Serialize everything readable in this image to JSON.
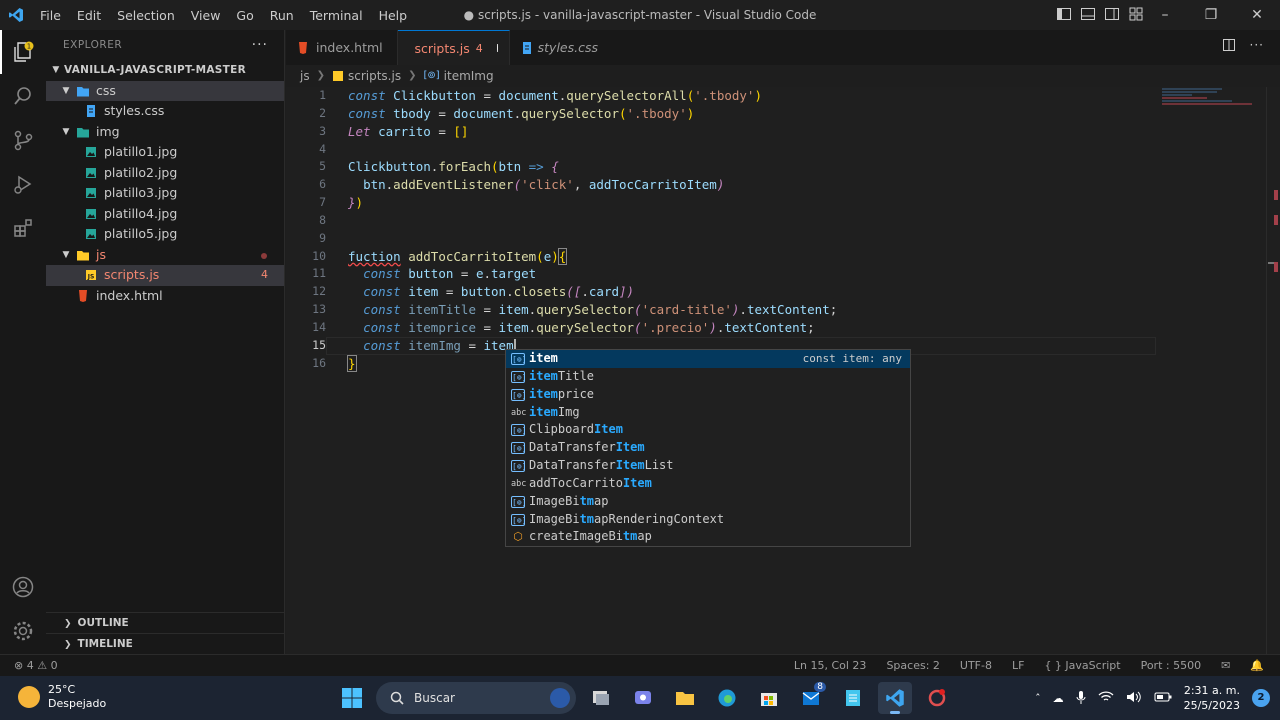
{
  "window": {
    "title": "● scripts.js - vanilla-javascript-master - Visual Studio Code",
    "menu": [
      "File",
      "Edit",
      "Selection",
      "View",
      "Go",
      "Run",
      "Terminal",
      "Help"
    ]
  },
  "sidebar": {
    "title": "EXPLORER",
    "root": "VANILLA-JAVASCRIPT-MASTER",
    "tree": [
      {
        "label": "css",
        "type": "folder"
      },
      {
        "label": "styles.css",
        "type": "css"
      },
      {
        "label": "img",
        "type": "folder"
      },
      {
        "label": "platillo1.jpg",
        "type": "image"
      },
      {
        "label": "platillo2.jpg",
        "type": "image"
      },
      {
        "label": "platillo3.jpg",
        "type": "image"
      },
      {
        "label": "platillo4.jpg",
        "type": "image"
      },
      {
        "label": "platillo5.jpg",
        "type": "image"
      },
      {
        "label": "js",
        "type": "folder"
      },
      {
        "label": "scripts.js",
        "type": "js",
        "problems": "4"
      },
      {
        "label": "index.html",
        "type": "html"
      }
    ],
    "outline": "OUTLINE",
    "timeline": "TIMELINE"
  },
  "tabs": [
    {
      "label": "index.html"
    },
    {
      "label": "scripts.js",
      "problems": "4"
    },
    {
      "label": "styles.css"
    }
  ],
  "breadcrumb": {
    "folder": "js",
    "file": "scripts.js",
    "symbol": "itemImg"
  },
  "editor": {
    "line_numbers": [
      "1",
      "2",
      "3",
      "4",
      "5",
      "6",
      "7",
      "8",
      "9",
      "10",
      "11",
      "12",
      "13",
      "14",
      "15",
      "16"
    ],
    "current_line": "15"
  },
  "suggest": {
    "items": [
      {
        "pre": "",
        "hl": "item",
        "post": "",
        "kind": "var"
      },
      {
        "pre": "",
        "hl": "item",
        "post": "Title",
        "kind": "var"
      },
      {
        "pre": "",
        "hl": "item",
        "post": "price",
        "kind": "var"
      },
      {
        "pre": "",
        "hl": "item",
        "post": "Img",
        "kind": "abc"
      },
      {
        "pre": "Clipboard",
        "hl": "Item",
        "post": "",
        "kind": "var"
      },
      {
        "pre": "DataTransfer",
        "hl": "Item",
        "post": "",
        "kind": "var"
      },
      {
        "pre": "DataTransfer",
        "hl": "Item",
        "post": "List",
        "kind": "var"
      },
      {
        "pre": "addTocCarrito",
        "hl": "Item",
        "post": "",
        "kind": "abc"
      },
      {
        "pre": "ImageBi",
        "hl": "tm",
        "post": "ap",
        "kind": "var"
      },
      {
        "pre": "ImageBi",
        "hl": "tm",
        "post": "apRenderingContext",
        "kind": "var"
      },
      {
        "pre": "createImageBi",
        "hl": "tm",
        "post": "ap",
        "kind": "cls"
      }
    ],
    "detail": "const item: any"
  },
  "statusbar": {
    "problems": "⊗ 4 ⚠ 0",
    "position": "Ln 15, Col 23",
    "spaces": "Spaces: 2",
    "encoding": "UTF-8",
    "eol": "LF",
    "language": "{ } JavaScript",
    "port": "Port : 5500"
  },
  "taskbar": {
    "temp": "25°C",
    "weather": "Despejado",
    "search": "Buscar",
    "time": "2:31 a. m.",
    "date": "25/5/2023",
    "notifications": "2",
    "badge": "8"
  },
  "colors": {
    "accent": "#0078d4",
    "error": "#f48771",
    "editor_bg": "#1f1f1f"
  }
}
